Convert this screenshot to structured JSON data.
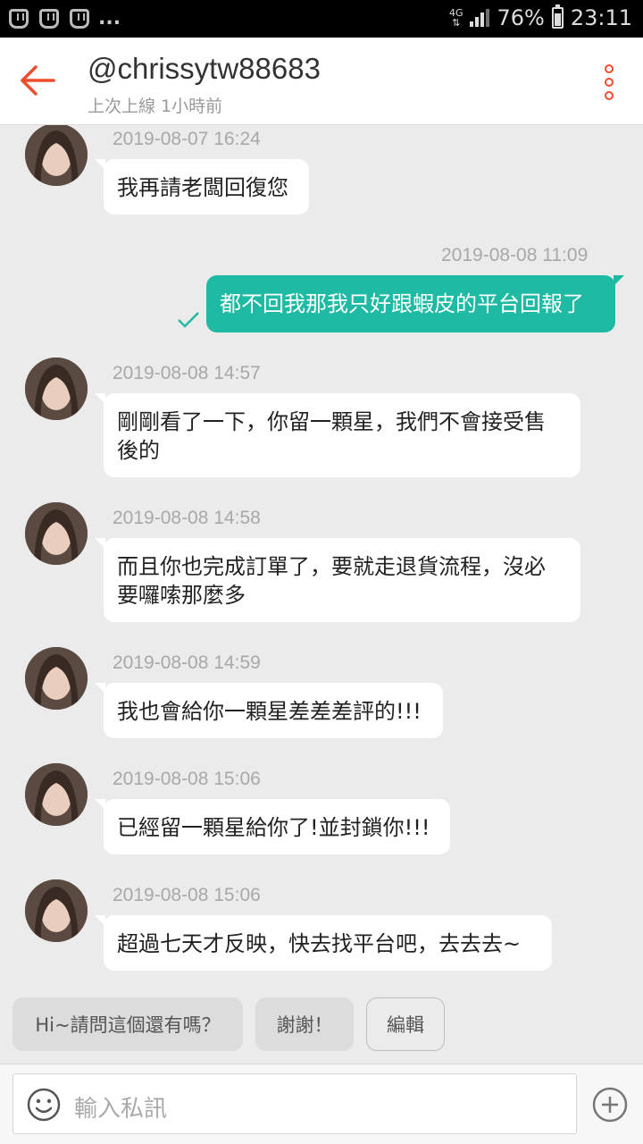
{
  "status_bar": {
    "network": "4G",
    "battery": "76%",
    "time": "23:11",
    "more": "...",
    "icons": [
      "app-icon",
      "app-icon",
      "app-icon",
      "signal-icon",
      "battery-icon"
    ]
  },
  "header": {
    "username": "@chrissytw88683",
    "last_seen": "上次上線 1小時前",
    "icons": [
      "back-arrow-icon",
      "more-vertical-icon"
    ],
    "accent_color": "#ee4d2d"
  },
  "messages": [
    {
      "side": "in",
      "timestamp": "2019-08-07 16:24",
      "text": "我再請老闆回復您"
    },
    {
      "side": "out",
      "timestamp": "2019-08-08 11:09",
      "text": "都不回我那我只好跟蝦皮的平台回報了",
      "status": "check-icon"
    },
    {
      "side": "in",
      "timestamp": "2019-08-08 14:57",
      "lines": [
        "剛剛看了一下，你留一顆星，我們不會接受售",
        "後的"
      ]
    },
    {
      "side": "in",
      "timestamp": "2019-08-08 14:58",
      "lines": [
        "而且你也完成訂單了，要就走退貨流程，沒必",
        "要囉嗦那麼多"
      ]
    },
    {
      "side": "in",
      "timestamp": "2019-08-08 14:59",
      "text": "我也會給你一顆星差差差評的!!!"
    },
    {
      "side": "in",
      "timestamp": "2019-08-08 15:06",
      "text": "已經留一顆星給你了!並封鎖你!!!"
    },
    {
      "side": "in",
      "timestamp": "2019-08-08 15:06",
      "text": "超過七天才反映，快去找平台吧，去去去~"
    }
  ],
  "quick_replies": {
    "q1": "Hi~請問這個還有嗎？",
    "q2": "謝謝！",
    "edit": "編輯"
  },
  "input": {
    "placeholder": "輸入私訊",
    "icons": [
      "emoji-icon",
      "add-icon"
    ]
  },
  "colors": {
    "outgoing_bubble": "#1fbaa4",
    "incoming_bubble": "#ffffff",
    "background": "#ebebeb"
  }
}
